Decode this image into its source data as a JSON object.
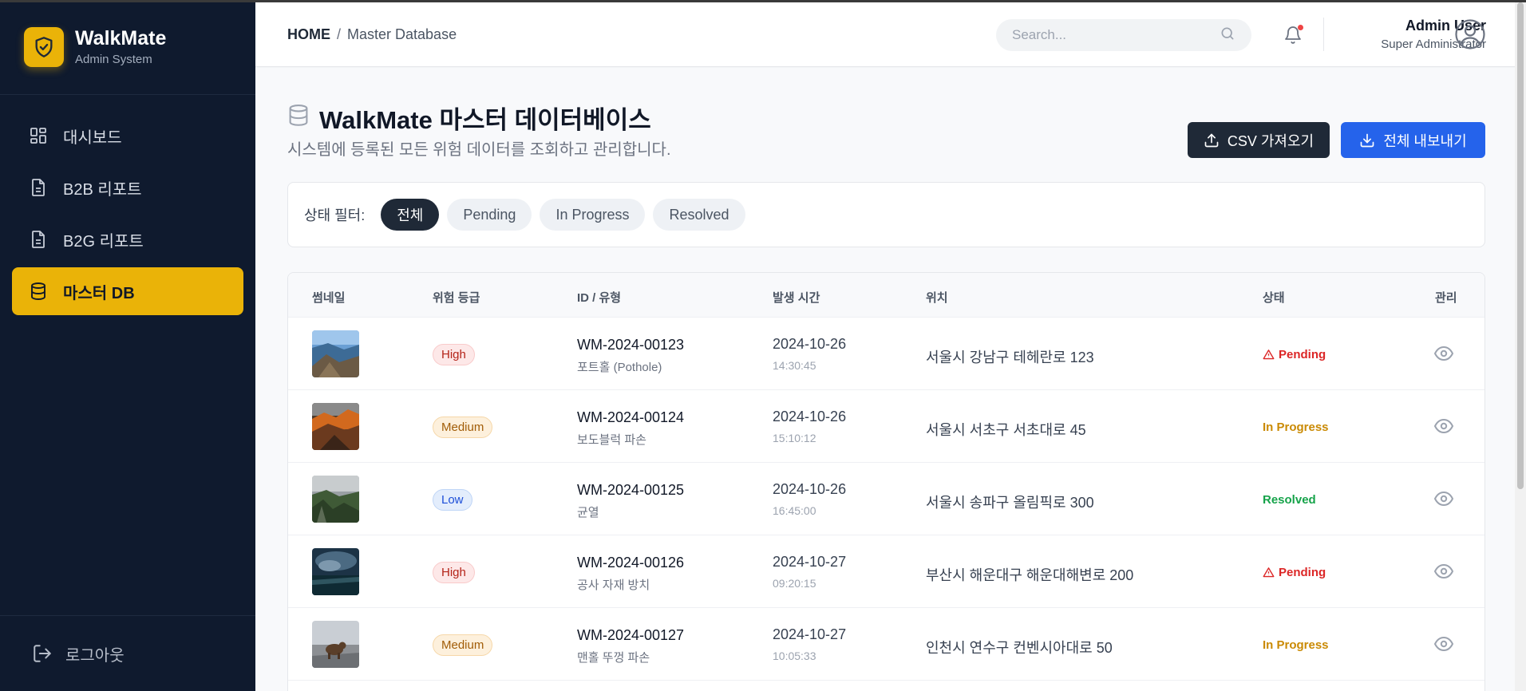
{
  "brand": {
    "name": "WalkMate",
    "subtitle": "Admin System"
  },
  "sidebar": {
    "items": [
      {
        "label": "대시보드",
        "icon": "dashboard-icon",
        "active": false
      },
      {
        "label": "B2B 리포트",
        "icon": "document-icon",
        "active": false
      },
      {
        "label": "B2G 리포트",
        "icon": "document-icon",
        "active": false
      },
      {
        "label": "마스터 DB",
        "icon": "database-icon",
        "active": true
      }
    ],
    "logout_label": "로그아웃"
  },
  "header": {
    "breadcrumb_home": "HOME",
    "breadcrumb_sep": "/",
    "breadcrumb_current": "Master Database",
    "search_placeholder": "Search...",
    "user_name": "Admin User",
    "user_role": "Super Administrator"
  },
  "page": {
    "title": "WalkMate 마스터 데이터베이스",
    "subtitle": "시스템에 등록된 모든 위험 데이터를 조회하고 관리합니다.",
    "csv_import_label": "CSV 가져오기",
    "export_all_label": "전체 내보내기"
  },
  "filter": {
    "label": "상태 필터:",
    "options": [
      "전체",
      "Pending",
      "In Progress",
      "Resolved"
    ],
    "selected": "전체"
  },
  "table": {
    "columns": [
      "썸네일",
      "위험 등급",
      "ID / 유형",
      "발생 시간",
      "위치",
      "상태",
      "관리"
    ],
    "rows": [
      {
        "risk": "High",
        "id": "WM-2024-00123",
        "type": "포트홀 (Pothole)",
        "date": "2024-10-26",
        "time": "14:30:45",
        "location": "서울시 강남구 테헤란로 123",
        "status": "Pending"
      },
      {
        "risk": "Medium",
        "id": "WM-2024-00124",
        "type": "보도블럭 파손",
        "date": "2024-10-26",
        "time": "15:10:12",
        "location": "서울시 서초구 서초대로 45",
        "status": "In Progress"
      },
      {
        "risk": "Low",
        "id": "WM-2024-00125",
        "type": "균열",
        "date": "2024-10-26",
        "time": "16:45:00",
        "location": "서울시 송파구 올림픽로 300",
        "status": "Resolved"
      },
      {
        "risk": "High",
        "id": "WM-2024-00126",
        "type": "공사 자재 방치",
        "date": "2024-10-27",
        "time": "09:20:15",
        "location": "부산시 해운대구 해운대해변로 200",
        "status": "Pending"
      },
      {
        "risk": "Medium",
        "id": "WM-2024-00127",
        "type": "맨홀 뚜껑 파손",
        "date": "2024-10-27",
        "time": "10:05:33",
        "location": "인천시 연수구 컨벤시아대로 50",
        "status": "In Progress"
      }
    ]
  },
  "colors": {
    "sidebar_bg": "#0f1a2e",
    "accent_yellow": "#eab308",
    "primary_blue": "#2563eb",
    "dark_button": "#1f2937",
    "pending_red": "#dc2626",
    "progress_amber": "#ca8a04",
    "resolved_green": "#16a34a"
  }
}
